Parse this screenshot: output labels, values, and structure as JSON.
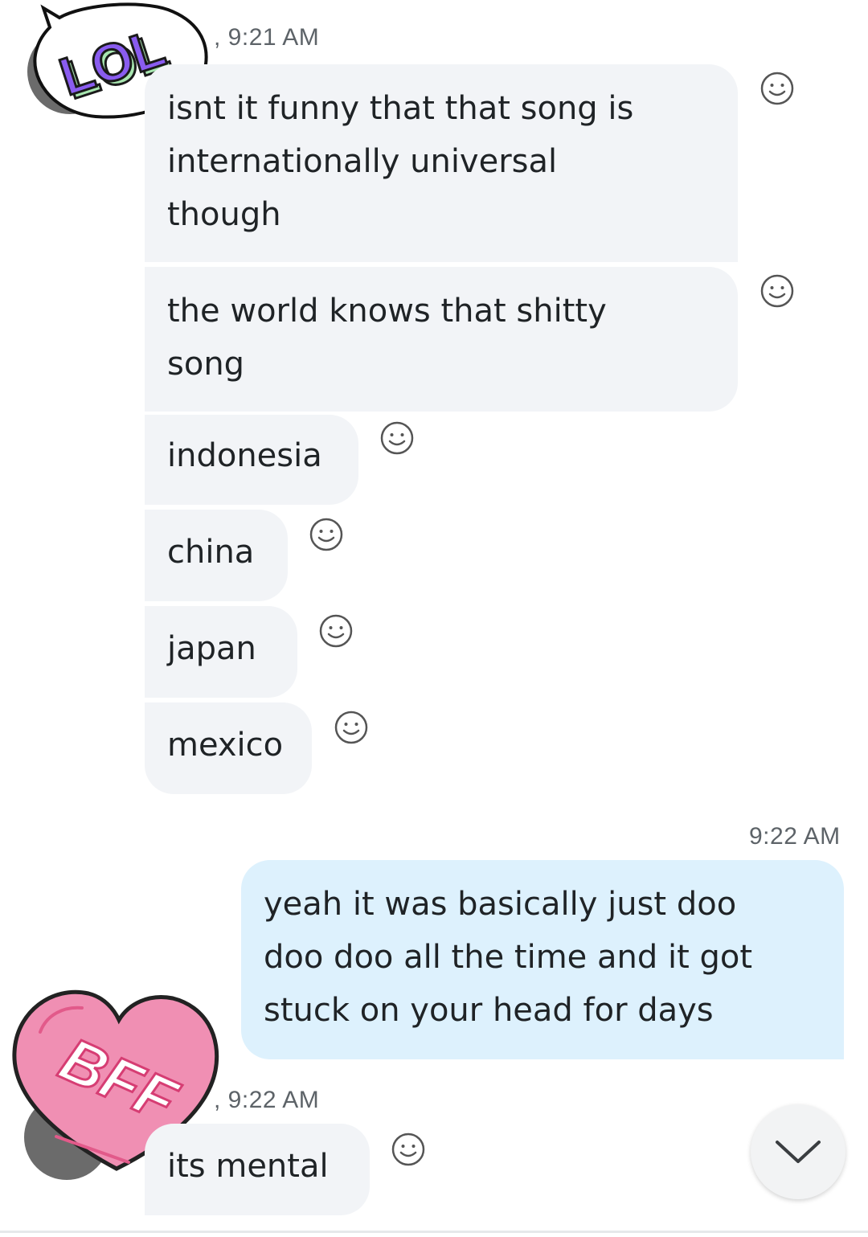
{
  "conversation": {
    "incoming_1": {
      "timestamp": "9:21 AM",
      "sticker_text": "LOL",
      "messages": [
        {
          "text": "isnt it funny that that song is\ninternationally universal\nthough"
        },
        {
          "text": "the world knows that shitty\nsong"
        },
        {
          "text": "indonesia"
        },
        {
          "text": "china"
        },
        {
          "text": "japan"
        },
        {
          "text": "mexico"
        }
      ]
    },
    "outgoing_1": {
      "timestamp": "9:22 AM",
      "messages": [
        {
          "text": "yeah it was basically just doo\ndoo doo all the time and it got\nstuck on your head for days"
        }
      ]
    },
    "incoming_2": {
      "timestamp": "9:22 AM",
      "sticker_text": "BFF",
      "messages": [
        {
          "text": "its mental"
        }
      ]
    }
  },
  "icons": {
    "reaction": "smiley-face-icon",
    "scroll": "chevron-down-icon"
  },
  "colors": {
    "incoming_bubble": "#f2f4f7",
    "outgoing_bubble": "#ddf1fd",
    "timestamp": "#5d6368",
    "sticker_lol_purple": "#8a5cf0",
    "sticker_lol_green": "#a8e6b0",
    "sticker_bff_pink": "#f08fb3"
  }
}
